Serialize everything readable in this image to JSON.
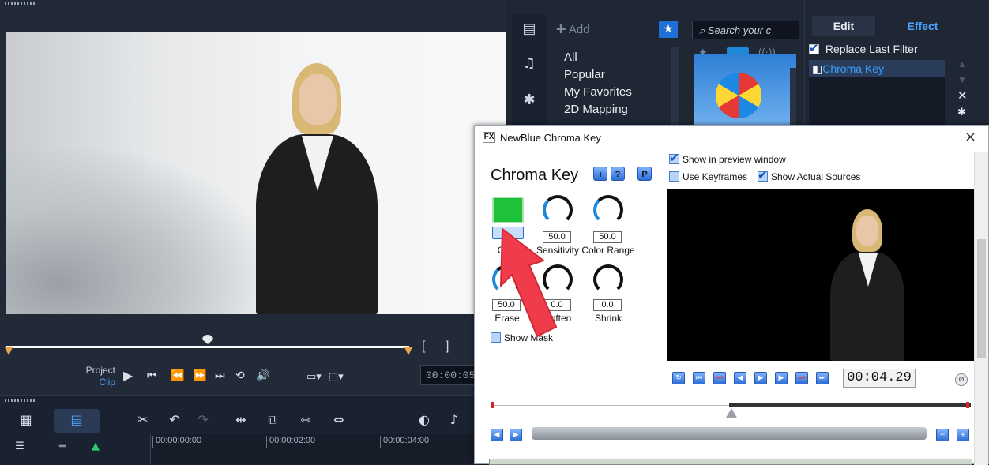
{
  "player": {
    "project_label": "Project",
    "clip_label": "Clip",
    "timecode": "00:00:05:",
    "mark_in": "[",
    "mark_out": "]"
  },
  "timeline": {
    "ticks": [
      "00:00:00:00",
      "00:00:02:00",
      "00:00:04:00"
    ]
  },
  "library": {
    "add_label": "Add",
    "categories": [
      "All",
      "Popular",
      "My Favorites",
      "2D Mapping"
    ],
    "search_placeholder": "Search your c"
  },
  "options": {
    "tab_edit": "Edit",
    "tab_effect": "Effect",
    "replace_last_filter": "Replace Last Filter",
    "filters": [
      "Chroma Key"
    ]
  },
  "dialog": {
    "window_title": "NewBlue Chroma Key",
    "fx_badge": "FX",
    "heading": "Chroma Key",
    "info_buttons": [
      "i",
      "?",
      "P"
    ],
    "show_in_preview": "Show in preview window",
    "use_keyframes": "Use Keyframes",
    "show_actual_sources": "Show Actual Sources",
    "show_mask": "Show Mask",
    "controls": [
      {
        "label": "Color",
        "value": ""
      },
      {
        "label": "Sensitivity",
        "value": "50.0"
      },
      {
        "label": "Color Range",
        "value": "50.0"
      },
      {
        "label": "Erase",
        "value": "50.0"
      },
      {
        "label": "Soften",
        "value": "0.0"
      },
      {
        "label": "Shrink",
        "value": "0.0"
      }
    ],
    "key_color": "#1ec23a",
    "time": "00:04.29",
    "close_symbol": "×"
  }
}
